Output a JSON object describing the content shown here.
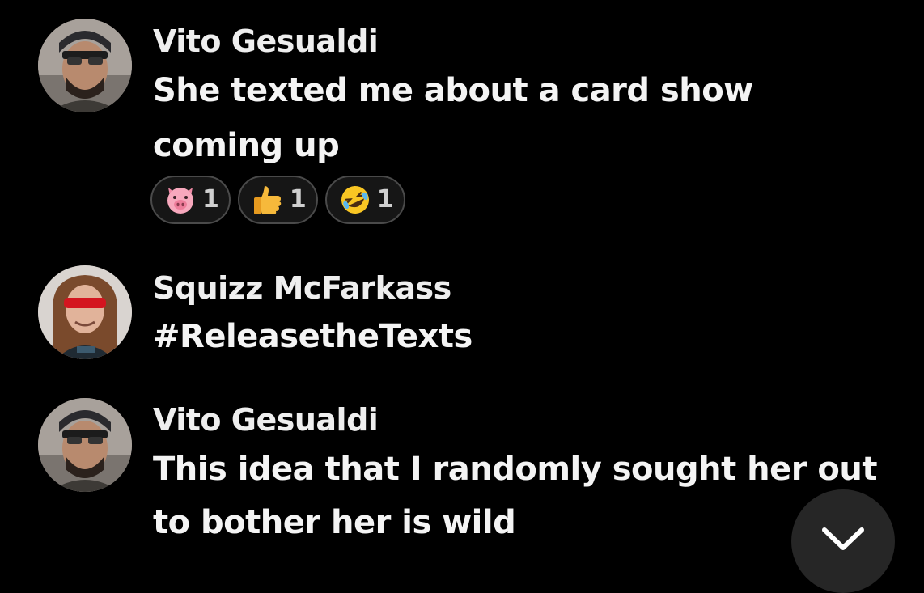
{
  "comments": [
    {
      "author": "Vito Gesualdi",
      "lines": [
        "She texted me about a card show",
        "coming up"
      ],
      "reactions": [
        {
          "emoji": "pig-face-icon",
          "count": "1"
        },
        {
          "emoji": "thumbs-up-icon",
          "count": "1"
        },
        {
          "emoji": "rolling-laughing-icon",
          "count": "1"
        }
      ]
    },
    {
      "author": "Squizz McFarkass",
      "lines": [
        "#ReleasetheTexts"
      ]
    },
    {
      "author": "Vito Gesualdi",
      "lines": [
        "This idea that I randomly sought her out",
        "to bother her is wild"
      ]
    }
  ],
  "scroll_button": {
    "icon": "chevron-down-icon"
  },
  "colors": {
    "background": "#000000",
    "text": "#f4f4f4",
    "reaction_border": "#4a4a4a",
    "scroll_button_bg": "#262626"
  }
}
